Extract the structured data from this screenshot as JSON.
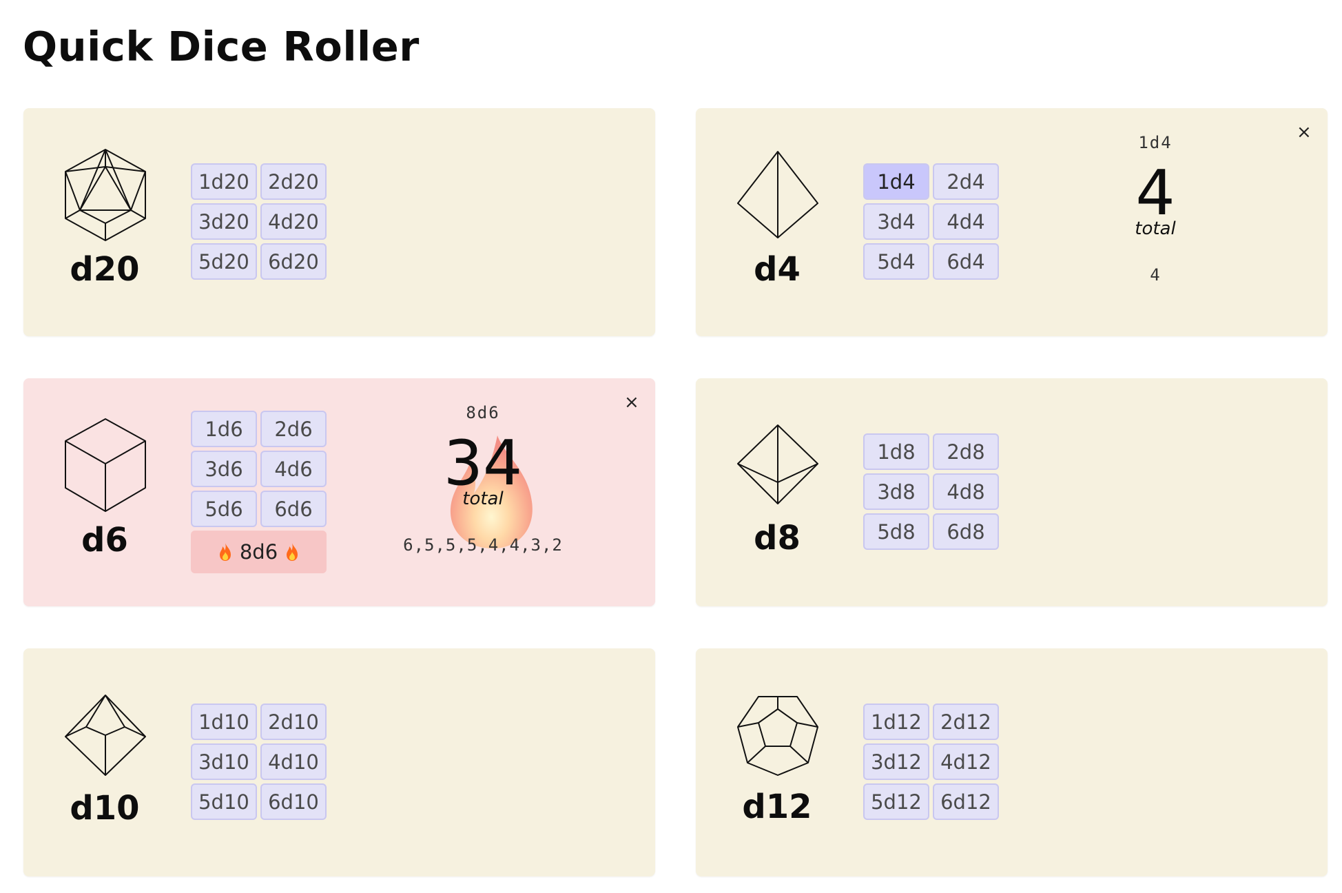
{
  "app": {
    "title": "Quick Dice Roller"
  },
  "dice": {
    "d20": {
      "label": "d20",
      "buttons": [
        "1d20",
        "2d20",
        "3d20",
        "4d20",
        "5d20",
        "6d20"
      ]
    },
    "d4": {
      "label": "d4",
      "buttons": [
        "1d4",
        "2d4",
        "3d4",
        "4d4",
        "5d4",
        "6d4"
      ],
      "active": "1d4",
      "result": {
        "expr": "1d4",
        "total": "4",
        "total_label": "total",
        "rolls": "4"
      },
      "close": "×"
    },
    "d6": {
      "label": "d6",
      "buttons": [
        "1d6",
        "2d6",
        "3d6",
        "4d6",
        "5d6",
        "6d6"
      ],
      "special": "8d6",
      "result": {
        "expr": "8d6",
        "total": "34",
        "total_label": "total",
        "rolls": "6,5,5,5,4,4,3,2"
      },
      "close": "×"
    },
    "d8": {
      "label": "d8",
      "buttons": [
        "1d8",
        "2d8",
        "3d8",
        "4d8",
        "5d8",
        "6d8"
      ]
    },
    "d10": {
      "label": "d10",
      "buttons": [
        "1d10",
        "2d10",
        "3d10",
        "4d10",
        "5d10",
        "6d10"
      ]
    },
    "d12": {
      "label": "d12",
      "buttons": [
        "1d12",
        "2d12",
        "3d12",
        "4d12",
        "5d12",
        "6d12"
      ]
    }
  },
  "colors": {
    "card_bg": "#f6f1df",
    "card_hot_bg": "#fae2e2",
    "button_bg": "#e3e2f7",
    "button_border": "#c9c7f0",
    "button_active_bg": "#c9c7fb",
    "fire_button_bg": "#f7c6c6"
  }
}
